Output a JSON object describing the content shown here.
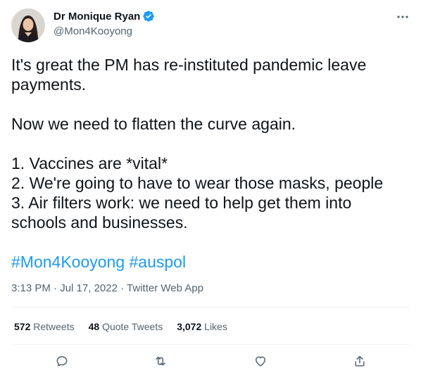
{
  "author": {
    "name": "Dr Monique Ryan",
    "handle": "@Mon4Kooyong"
  },
  "tweet": {
    "lines": [
      "It's great the PM has re-instituted pandemic leave",
      "payments.",
      "Now we need to flatten the curve again.",
      "1. Vaccines are *vital*",
      "2. We're going to have to wear those masks, people",
      "3. Air filters work: we need to help get them into",
      "schools and businesses."
    ],
    "hashtags": [
      "#Mon4Kooyong",
      "#auspol"
    ],
    "time": "3:13 PM",
    "separator": "·",
    "date": "Jul 17, 2022",
    "source": "Twitter Web App"
  },
  "stats": {
    "retweets_count": "572",
    "retweets_label": "Retweets",
    "quotes_count": "48",
    "quotes_label": "Quote Tweets",
    "likes_count": "3,072",
    "likes_label": "Likes"
  },
  "colors": {
    "link": "#1d9bf0",
    "verified": "#1d9bf0",
    "secondary": "#536471"
  },
  "icons": {
    "verified": "verified-badge-icon",
    "more": "more-options-icon",
    "reply": "reply-icon",
    "retweet": "retweet-icon",
    "like": "like-icon",
    "share": "share-icon"
  }
}
